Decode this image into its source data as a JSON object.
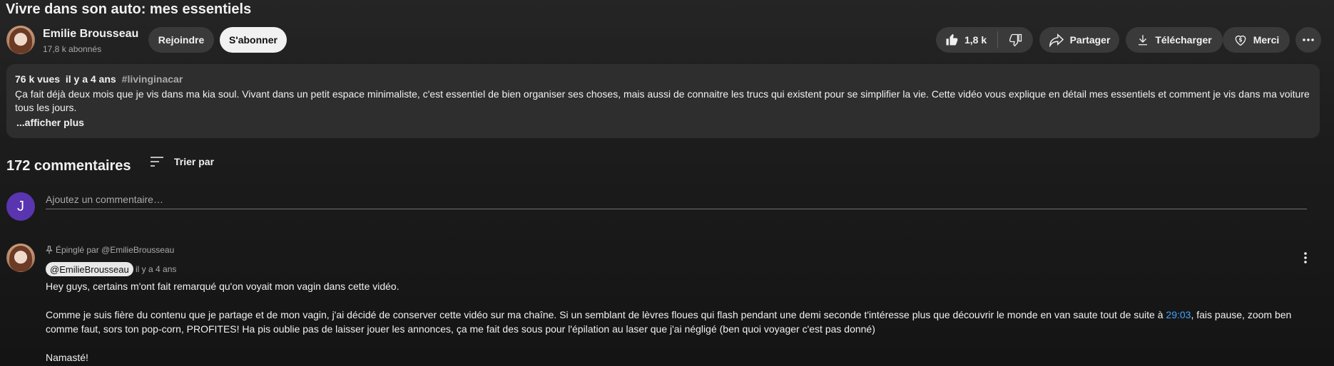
{
  "video": {
    "title": "Vivre dans son auto: mes essentiels"
  },
  "channel": {
    "name": "Emilie Brousseau",
    "subscribers": "17,8 k abonnés",
    "join_label": "Rejoindre",
    "subscribe_label": "S'abonner"
  },
  "actions": {
    "likes": "1,8 k",
    "share_label": "Partager",
    "download_label": "Télécharger",
    "thanks_label": "Merci"
  },
  "description": {
    "views": "76 k vues",
    "age": "il y a 4 ans",
    "hashtag": "#livinginacar",
    "text": "Ça fait déjà deux mois que je vis dans ma kia soul. Vivant dans un petit espace minimaliste, c'est essentiel de bien organiser ses choses, mais aussi de connaitre les trucs qui existent pour se simplifier la vie. Cette vidéo vous explique en détail mes essentiels et comment je vis dans ma voiture tous les jours.",
    "more_label": "...afficher plus"
  },
  "comments": {
    "count_label": "172 commentaires",
    "sort_label": "Trier par",
    "user_initial": "J",
    "placeholder": "Ajoutez un commentaire…",
    "pinned": {
      "pinned_label": "Épinglé par @EmilieBrousseau",
      "author": "@EmilieBrousseau",
      "time": "il y a 4 ans",
      "line1": "Hey guys, certains m'ont fait remarqué qu'on voyait mon vagin dans cette vidéo.",
      "line2_before": "Comme je suis fière du contenu que je partage et de mon vagin, j'ai décidé de conserver cette vidéo sur ma chaîne. Si un semblant de lèvres floues qui flash pendant une demi seconde t'intéresse plus que découvrir le monde en van saute tout de suite à ",
      "timestamp": "29:03",
      "line2_after": ", fais pause, zoom ben comme faut, sors ton pop-corn, PROFITES! Ha pis oublie pas de laisser jouer les annonces, ça me fait des sous pour l'épilation au laser que j'ai négligé (ben quoi voyager c'est pas donné)",
      "line3": "Namasté!"
    }
  },
  "colors": {
    "background": "#1c1c1c",
    "pill": "#3a3a3a",
    "link": "#3ea6ff",
    "avatar_user": "#5a35b0"
  }
}
